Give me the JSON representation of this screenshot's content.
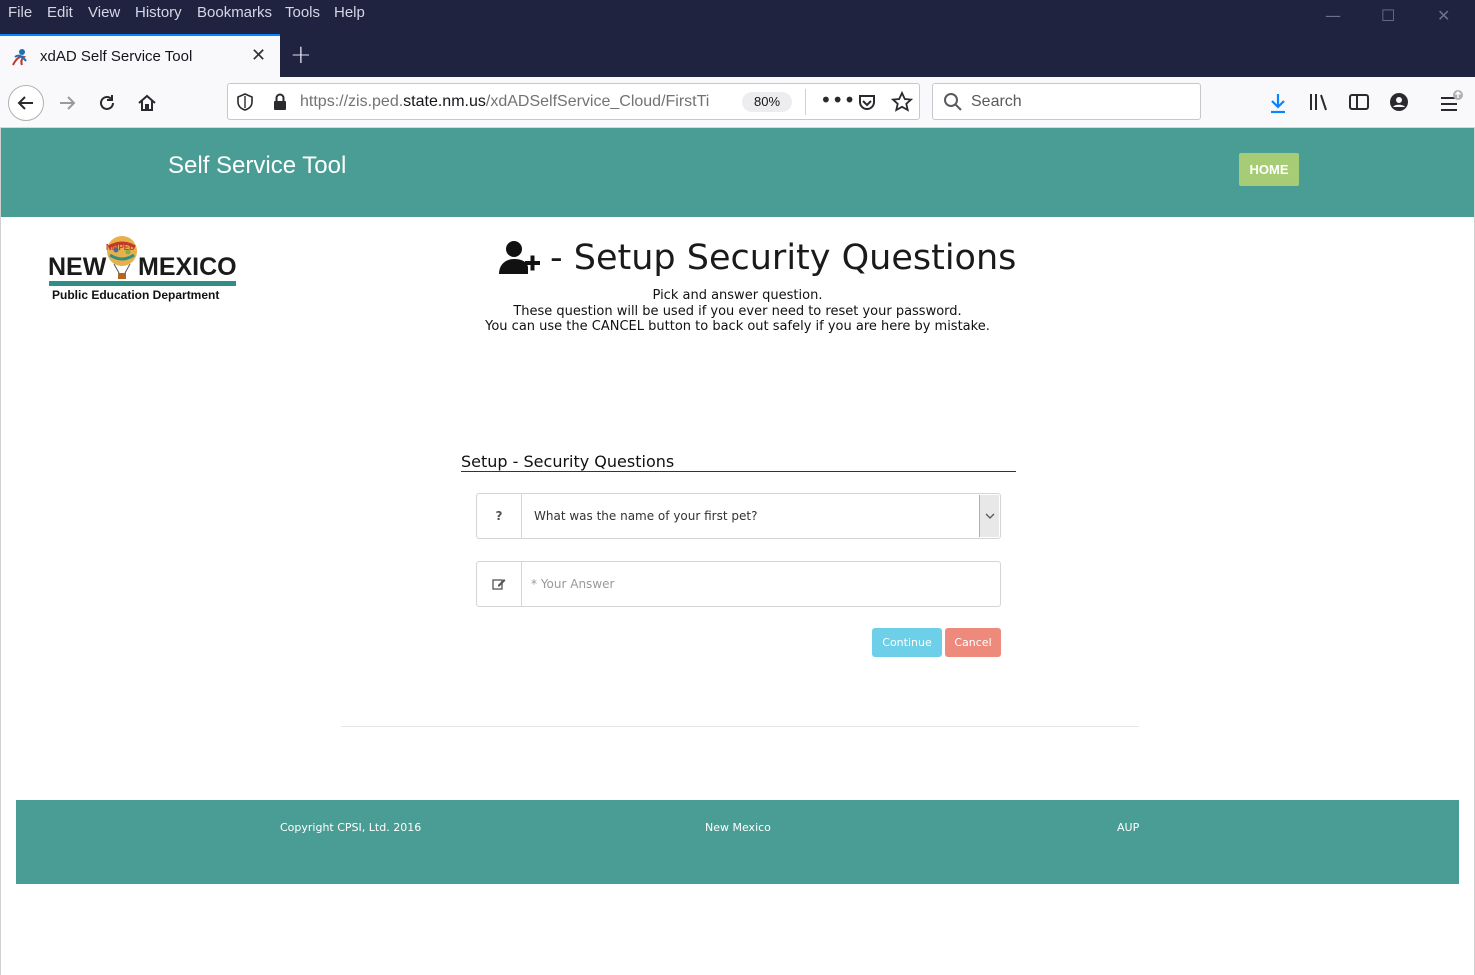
{
  "browser": {
    "menu": [
      "File",
      "Edit",
      "View",
      "History",
      "Bookmarks",
      "Tools",
      "Help"
    ],
    "tab_title": "xdAD Self Service Tool",
    "url_prefix": "https://zis.ped.",
    "url_domain": "state.nm.us",
    "url_path": "/xdADSelfService_Cloud/FirstTi",
    "zoom": "80%",
    "search_placeholder": "Search"
  },
  "header": {
    "brand": "Self Service Tool",
    "home_label": "HOME"
  },
  "logo": {
    "word1": "NEW",
    "word2": "MEXICO",
    "badge": "NMPED",
    "subtitle": "Public Education Department"
  },
  "main": {
    "title": "- Setup Security Questions",
    "desc_line1": "Pick and answer question.",
    "desc_line2": "These question will be used if you ever need to reset your password.",
    "desc_line3": "You can use the CANCEL button to back out safely if you are here by mistake.",
    "section_title": "Setup - Security Questions",
    "question_addon": "?",
    "question_selected": "What was the name of your first pet?",
    "answer_placeholder": "* Your Answer",
    "continue_label": "Continue",
    "cancel_label": "Cancel"
  },
  "footer": {
    "copyright": "Copyright CPSI, Ltd. 2016",
    "state": "New Mexico",
    "aup": "AUP"
  },
  "colors": {
    "teal": "#4a9d94",
    "home_green": "#a6cd76",
    "continue_blue": "#6dd0e8",
    "cancel_red": "#ee8a7c"
  }
}
